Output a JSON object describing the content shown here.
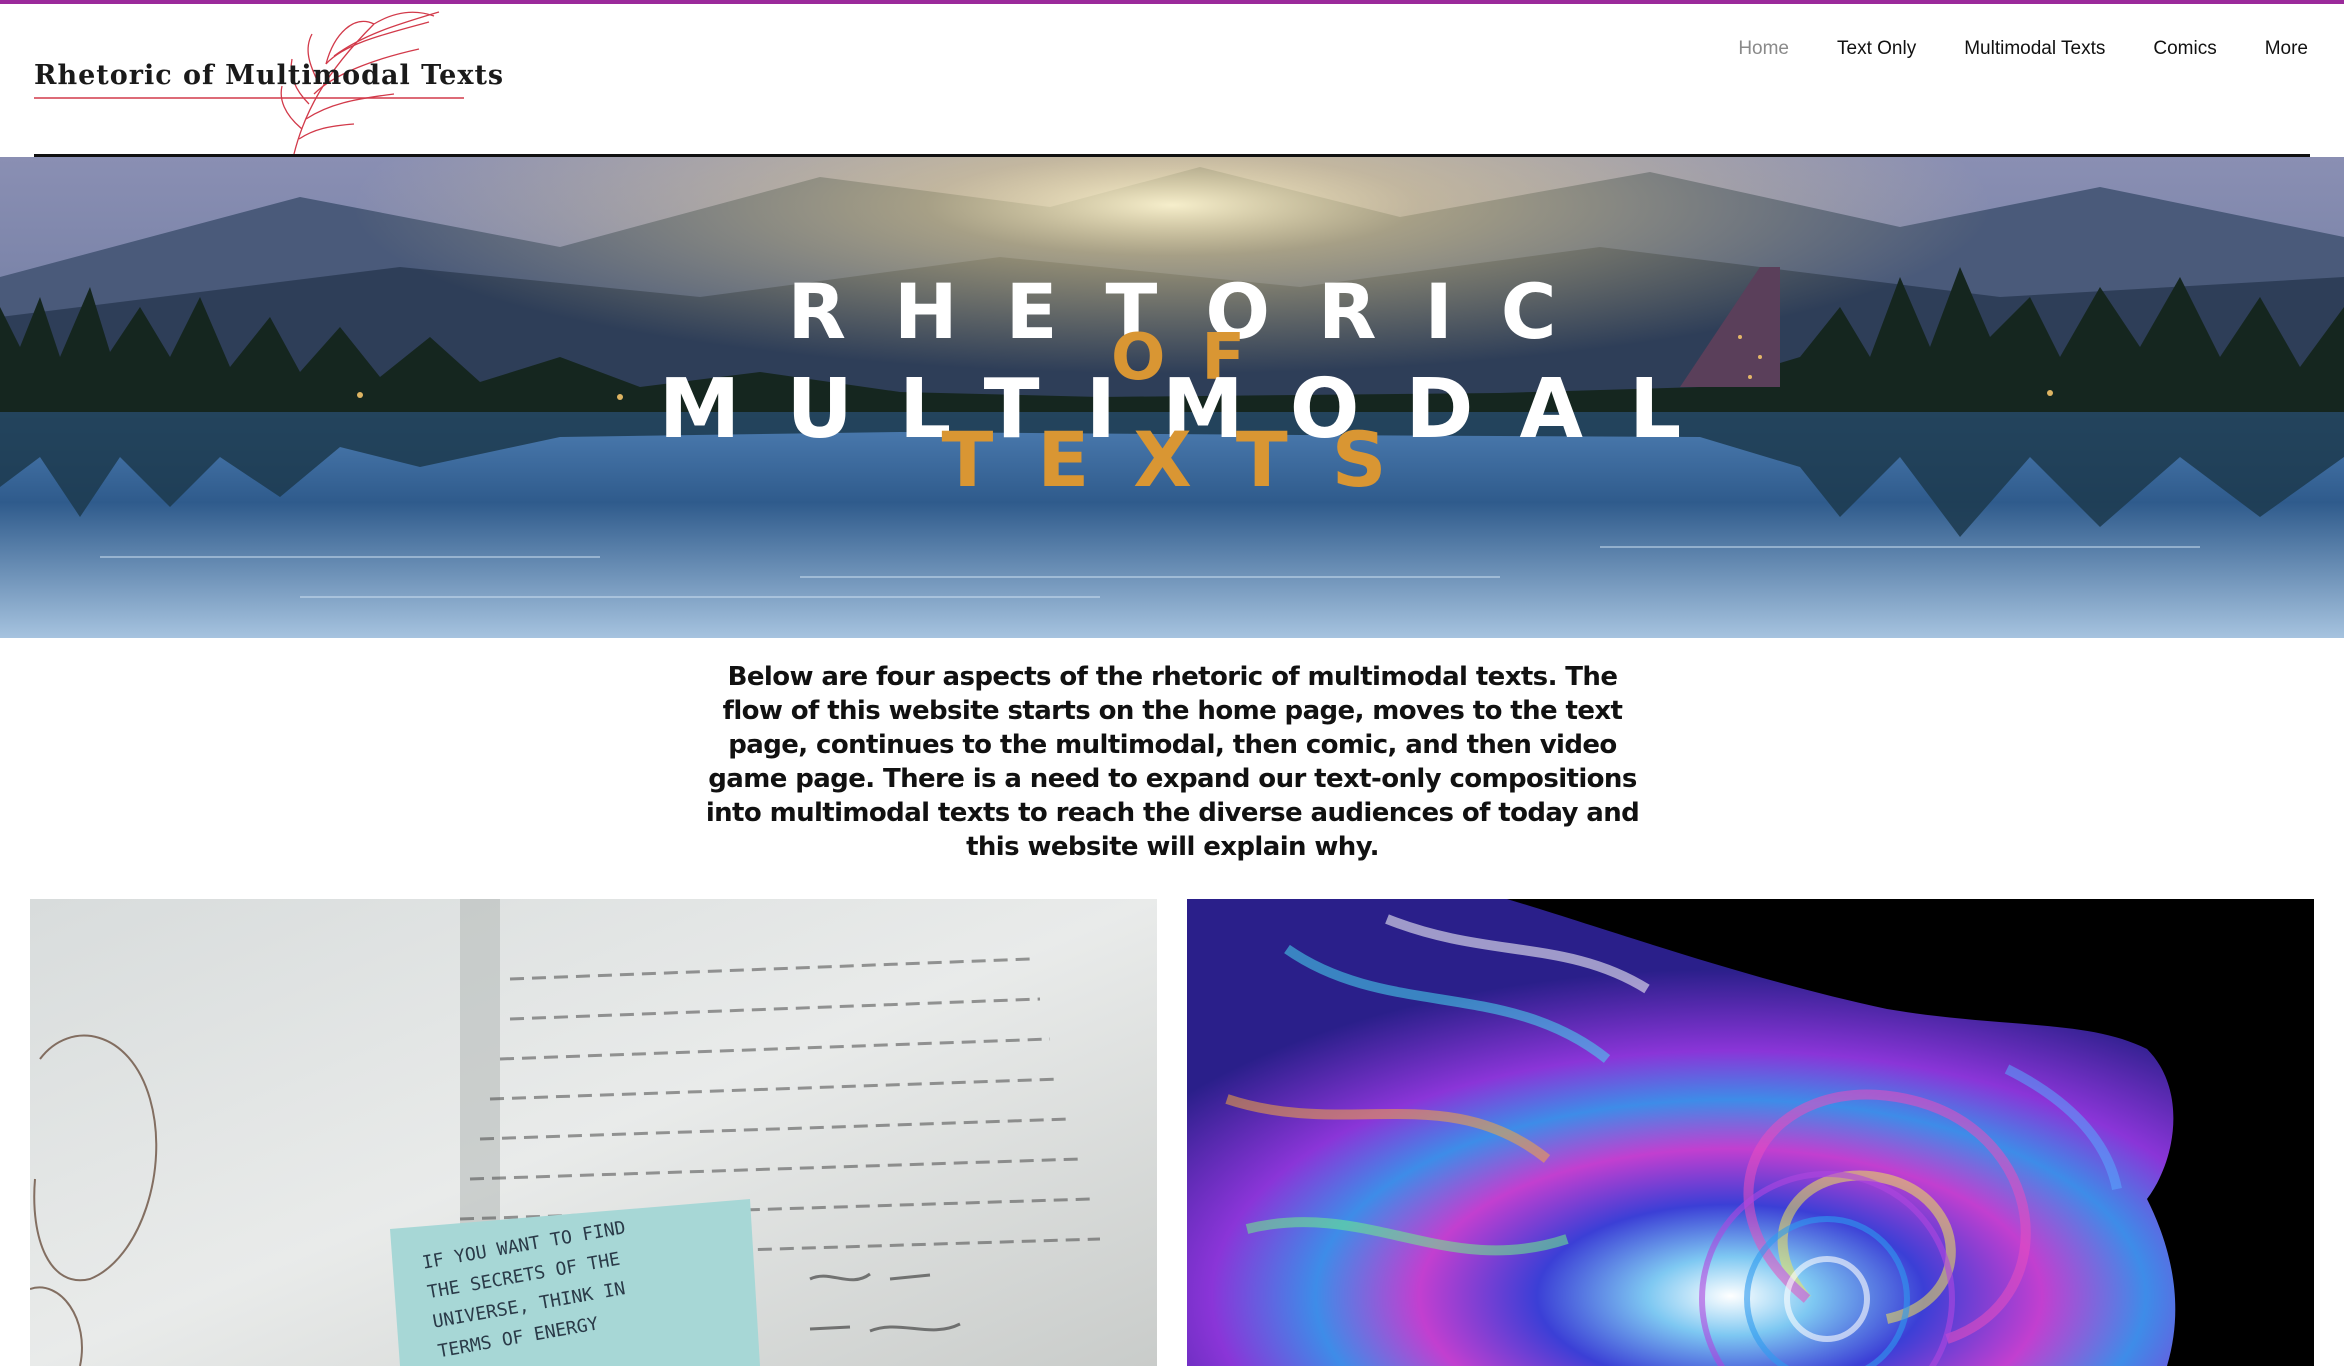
{
  "site": {
    "logo_text": "Rhetoric of Multimodal Texts"
  },
  "nav": {
    "items": [
      {
        "label": "Home",
        "active": true
      },
      {
        "label": "Text Only",
        "active": false
      },
      {
        "label": "Multimodal Texts",
        "active": false
      },
      {
        "label": "Comics",
        "active": false
      },
      {
        "label": "More",
        "active": false
      }
    ]
  },
  "hero": {
    "line1": "RHETORIC",
    "line2": "OF",
    "line3": "MULTIMODAL",
    "line4": "TEXTS"
  },
  "intro": {
    "text": "Below are four aspects of the rhetoric of multimodal texts.  The flow of this website starts on the home page, moves to the text page, continues to the multimodal, then comic, and then video game page.  There is a need to expand our text-only compositions into multimodal texts to reach the diverse audiences of today and this website will explain why."
  },
  "cards": {
    "left": {
      "sticky_note": "IF YOU WANT TO FIND\nTHE SECRETS OF THE\nUNIVERSE, THINK IN\nTERMS OF ENERGY"
    }
  },
  "colors": {
    "accent_bar": "#9b2a9b",
    "hero_gold": "#d99633",
    "nav_active": "#8a8a8a"
  }
}
